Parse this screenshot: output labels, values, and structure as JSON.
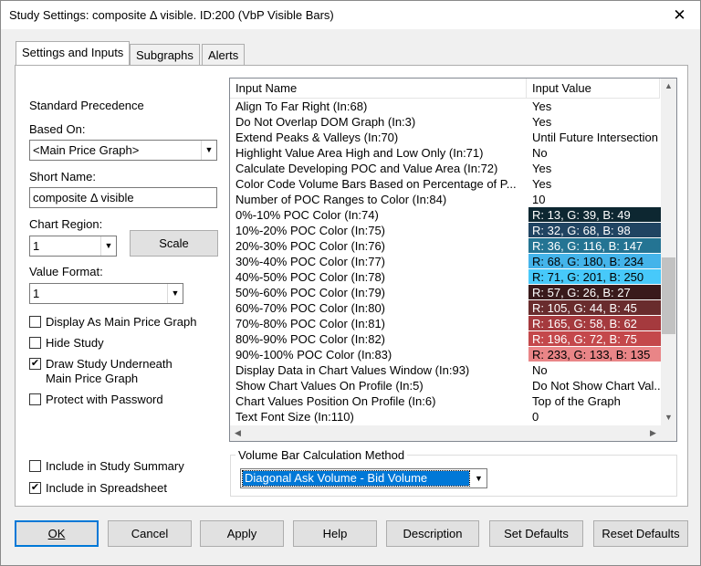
{
  "window": {
    "title": "Study Settings: composite Δ visible. ID:200 (VbP Visible Bars)",
    "close": "✕"
  },
  "tabs": [
    "Settings and Inputs",
    "Subgraphs",
    "Alerts"
  ],
  "left": {
    "standard_precedence": "Standard Precedence",
    "based_on_label": "Based On:",
    "based_on_value": "<Main Price Graph>",
    "short_name_label": "Short Name:",
    "short_name_value": "composite Δ visible",
    "chart_region_label": "Chart Region:",
    "chart_region_value": "1",
    "scale_button": "Scale",
    "value_format_label": "Value Format:",
    "value_format_value": "1",
    "checkboxes": [
      {
        "label": "Display As Main Price Graph",
        "checked": false
      },
      {
        "label": "Hide Study",
        "checked": false
      },
      {
        "label": "Draw Study Underneath",
        "label2": "Main Price Graph",
        "checked": true
      },
      {
        "label": "Protect with Password",
        "checked": false
      }
    ],
    "bottom_checkboxes": [
      {
        "label": "Include in Study Summary",
        "checked": false
      },
      {
        "label": "Include in Spreadsheet",
        "checked": true
      }
    ]
  },
  "grid": {
    "col_name": "Input Name",
    "col_value": "Input Value",
    "rows": [
      {
        "name": "Align To Far Right  (In:68)",
        "value": "Yes"
      },
      {
        "name": "Do Not Overlap DOM Graph  (In:3)",
        "value": "Yes"
      },
      {
        "name": "Extend Peaks & Valleys  (In:70)",
        "value": "Until Future Intersection"
      },
      {
        "name": "Highlight Value Area High and Low Only  (In:71)",
        "value": "No"
      },
      {
        "name": "Calculate Developing POC and Value Area  (In:72)",
        "value": "Yes"
      },
      {
        "name": "Color Code Volume Bars Based on Percentage of P...",
        "value": "Yes"
      },
      {
        "name": "Number of POC Ranges to Color  (In:84)",
        "value": "10"
      },
      {
        "name": "0%-10% POC Color  (In:74)",
        "value": "R: 13, G: 39, B: 49",
        "bg": "#0d2731",
        "fg": "#ffffff"
      },
      {
        "name": "10%-20% POC Color  (In:75)",
        "value": "R: 32, G: 68, B: 98",
        "bg": "#204462",
        "fg": "#ffffff"
      },
      {
        "name": "20%-30% POC Color  (In:76)",
        "value": "R: 36, G: 116, B: 147",
        "bg": "#247493",
        "fg": "#ffffff"
      },
      {
        "name": "30%-40% POC Color  (In:77)",
        "value": "R: 68, G: 180, B: 234",
        "bg": "#44b4ea",
        "fg": "#000000"
      },
      {
        "name": "40%-50% POC Color  (In:78)",
        "value": "R: 71, G: 201, B: 250",
        "bg": "#47c9fa",
        "fg": "#000000"
      },
      {
        "name": "50%-60% POC Color  (In:79)",
        "value": "R: 57, G: 26, B: 27",
        "bg": "#391a1b",
        "fg": "#ffffff"
      },
      {
        "name": "60%-70% POC Color  (In:80)",
        "value": "R: 105, G: 44, B: 45",
        "bg": "#692c2d",
        "fg": "#ffffff"
      },
      {
        "name": "70%-80% POC Color  (In:81)",
        "value": "R: 165, G: 58, B: 62",
        "bg": "#a53a3e",
        "fg": "#ffffff"
      },
      {
        "name": "80%-90% POC Color  (In:82)",
        "value": "R: 196, G: 72, B: 75",
        "bg": "#c4484b",
        "fg": "#ffffff"
      },
      {
        "name": "90%-100% POC Color  (In:83)",
        "value": "R: 233, G: 133, B: 135",
        "bg": "#e98587",
        "fg": "#000000"
      },
      {
        "name": "Display Data in Chart Values Window  (In:93)",
        "value": "No"
      },
      {
        "name": "Show Chart Values On Profile  (In:5)",
        "value": "Do Not Show Chart Val..."
      },
      {
        "name": "Chart Values Position On Profile  (In:6)",
        "value": "Top of the Graph"
      },
      {
        "name": "Text Font Size  (In:110)",
        "value": "0"
      }
    ],
    "vscroll_level": 0.55
  },
  "group": {
    "title": "Volume Bar Calculation Method",
    "selected": "Diagonal Ask Volume - Bid Volume"
  },
  "buttons": [
    "OK",
    "Cancel",
    "Apply",
    "Help",
    "Description",
    "Set Defaults",
    "Reset Defaults"
  ]
}
